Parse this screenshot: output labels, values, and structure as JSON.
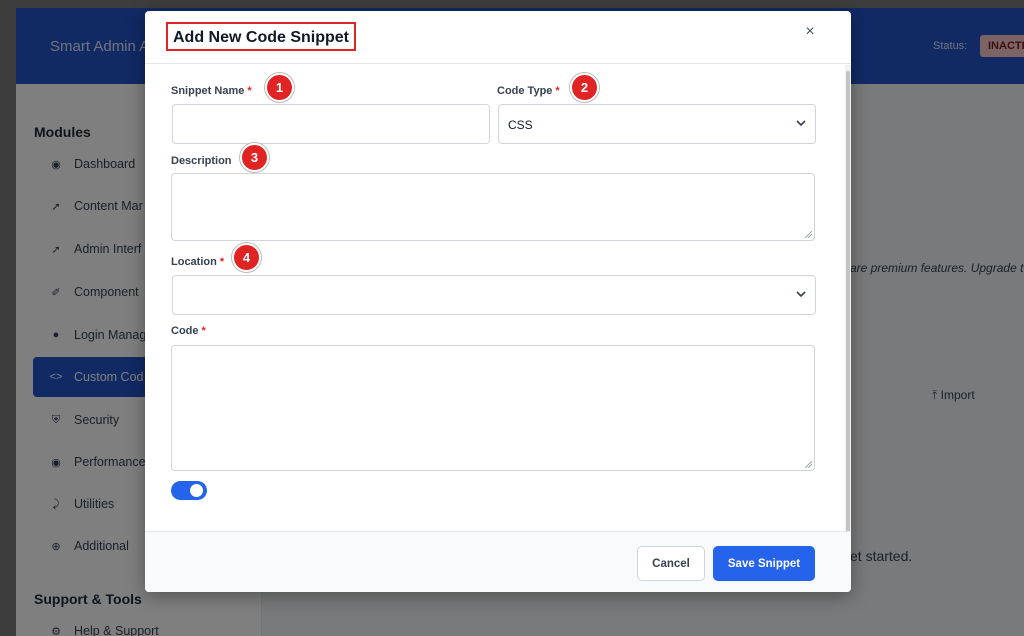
{
  "background": {
    "app_title": "Smart Admin A",
    "status_label": "Status:",
    "status_badge": "INACTI",
    "sidebar": {
      "modules_heading": "Modules",
      "items": [
        {
          "label": "Dashboard",
          "icon": "palette-icon"
        },
        {
          "label": "Content Mar",
          "icon": "pin-icon"
        },
        {
          "label": "Admin Interf",
          "icon": "pin-icon"
        },
        {
          "label": "Component",
          "icon": "brush-icon"
        },
        {
          "label": "Login Manag",
          "icon": "user-icon"
        },
        {
          "label": "Custom Cod",
          "icon": "code-icon",
          "active": true
        },
        {
          "label": "Security",
          "icon": "shield-icon"
        },
        {
          "label": "Performance",
          "icon": "palette-icon"
        },
        {
          "label": "Utilities",
          "icon": "wrench-icon"
        },
        {
          "label": "Additional",
          "icon": "plus-circle-icon"
        }
      ],
      "support_heading": "Support & Tools",
      "support_items": [
        {
          "label": "Help & Support",
          "icon": "gear-icon"
        }
      ]
    },
    "main": {
      "premium_note": "are premium features. Upgrade t",
      "import_label": "Import",
      "empty_hint": "et started."
    },
    "colors": {
      "accent": "#2355c8",
      "button": "#2563eb",
      "required": "#e02424"
    }
  },
  "modal": {
    "title": "Add New Code Snippet",
    "close_glyph": "×",
    "required_mark": "*",
    "fields": {
      "snippet_name": {
        "label": "Snippet Name",
        "value": "",
        "marker": "1"
      },
      "code_type": {
        "label": "Code Type",
        "value": "CSS",
        "marker": "2"
      },
      "description": {
        "label": "Description",
        "value": "",
        "marker": "3"
      },
      "location": {
        "label": "Location",
        "value": "",
        "marker": "4"
      },
      "code": {
        "label": "Code",
        "value": ""
      }
    },
    "toggle_on": true,
    "buttons": {
      "cancel": "Cancel",
      "save": "Save Snippet"
    }
  }
}
